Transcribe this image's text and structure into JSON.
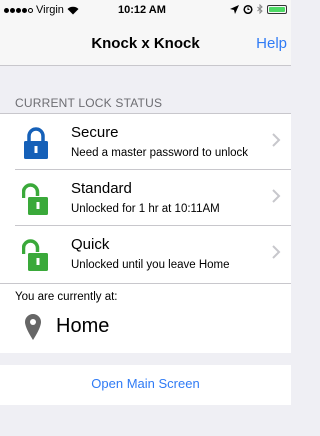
{
  "status_bar": {
    "carrier": "Virgin",
    "time": "10:12 AM"
  },
  "nav": {
    "title": "Knock x Knock",
    "help": "Help"
  },
  "lock_status": {
    "header": "CURRENT LOCK STATUS",
    "options": [
      {
        "title": "Secure",
        "subtitle": "Need a master password to unlock",
        "icon": "lock-closed-icon",
        "color": "#1560b8"
      },
      {
        "title": "Standard",
        "subtitle": "Unlocked for 1 hr at 10:11AM",
        "icon": "lock-open-icon",
        "color": "#3aa93a"
      },
      {
        "title": "Quick",
        "subtitle": "Unlocked until you leave Home",
        "icon": "lock-open-icon",
        "color": "#3aa93a"
      }
    ]
  },
  "location": {
    "label": "You are currently at:",
    "place": "Home"
  },
  "footer": {
    "open_main": "Open Main Screen"
  },
  "colors": {
    "accent": "#2f7bf5",
    "background": "#efeff4"
  }
}
